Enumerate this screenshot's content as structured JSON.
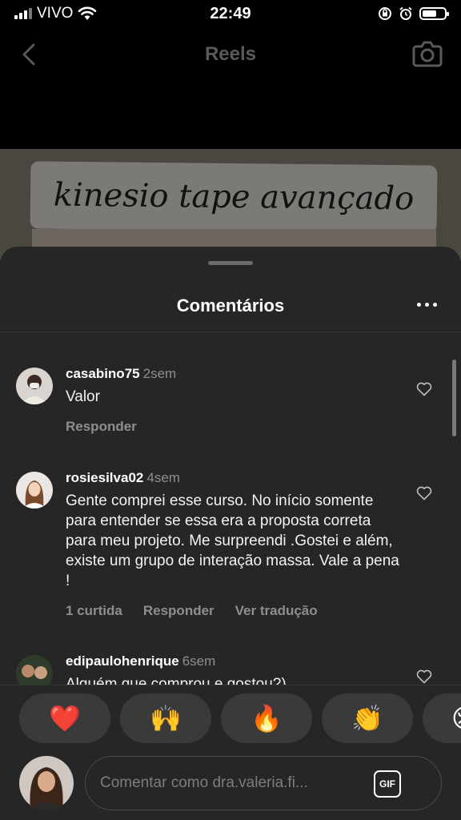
{
  "status_bar": {
    "carrier": "VIVO",
    "time": "22:49",
    "battery_level": 0.65
  },
  "nav": {
    "title": "Reels"
  },
  "video": {
    "banner_text": "kinesio tape avançado"
  },
  "sheet": {
    "title": "Comentários"
  },
  "comments": [
    {
      "username": "casabino75",
      "time": "2sem",
      "text": "Valor",
      "actions": [
        "Responder"
      ]
    },
    {
      "username": "rosiesilva02",
      "time": "4sem",
      "text": "Gente comprei esse curso. No início somente para entender se essa era a proposta correta para meu projeto. Me surpreendi .Gostei e além, existe um grupo de interação massa. Vale a pena !",
      "actions": [
        "1 curtida",
        "Responder",
        "Ver tradução"
      ]
    },
    {
      "username": "edipaulohenrique",
      "time": "6sem",
      "text": "Alguém que comprou e gostou?)",
      "actions": []
    }
  ],
  "reactions": [
    "❤️",
    "🙌",
    "🔥",
    "👏",
    "😢"
  ],
  "input": {
    "placeholder": "Comentar como dra.valeria.fi...",
    "gif_label": "GIF"
  },
  "icons": {
    "back": "chevron-left-icon",
    "camera": "camera-icon",
    "more": "more-icon",
    "heart": "heart-icon",
    "gif": "gif-icon"
  },
  "colors": {
    "sheet_bg": "#262626",
    "muted_text": "#8e8e8e",
    "reaction_pill": "#3a3a3a"
  }
}
